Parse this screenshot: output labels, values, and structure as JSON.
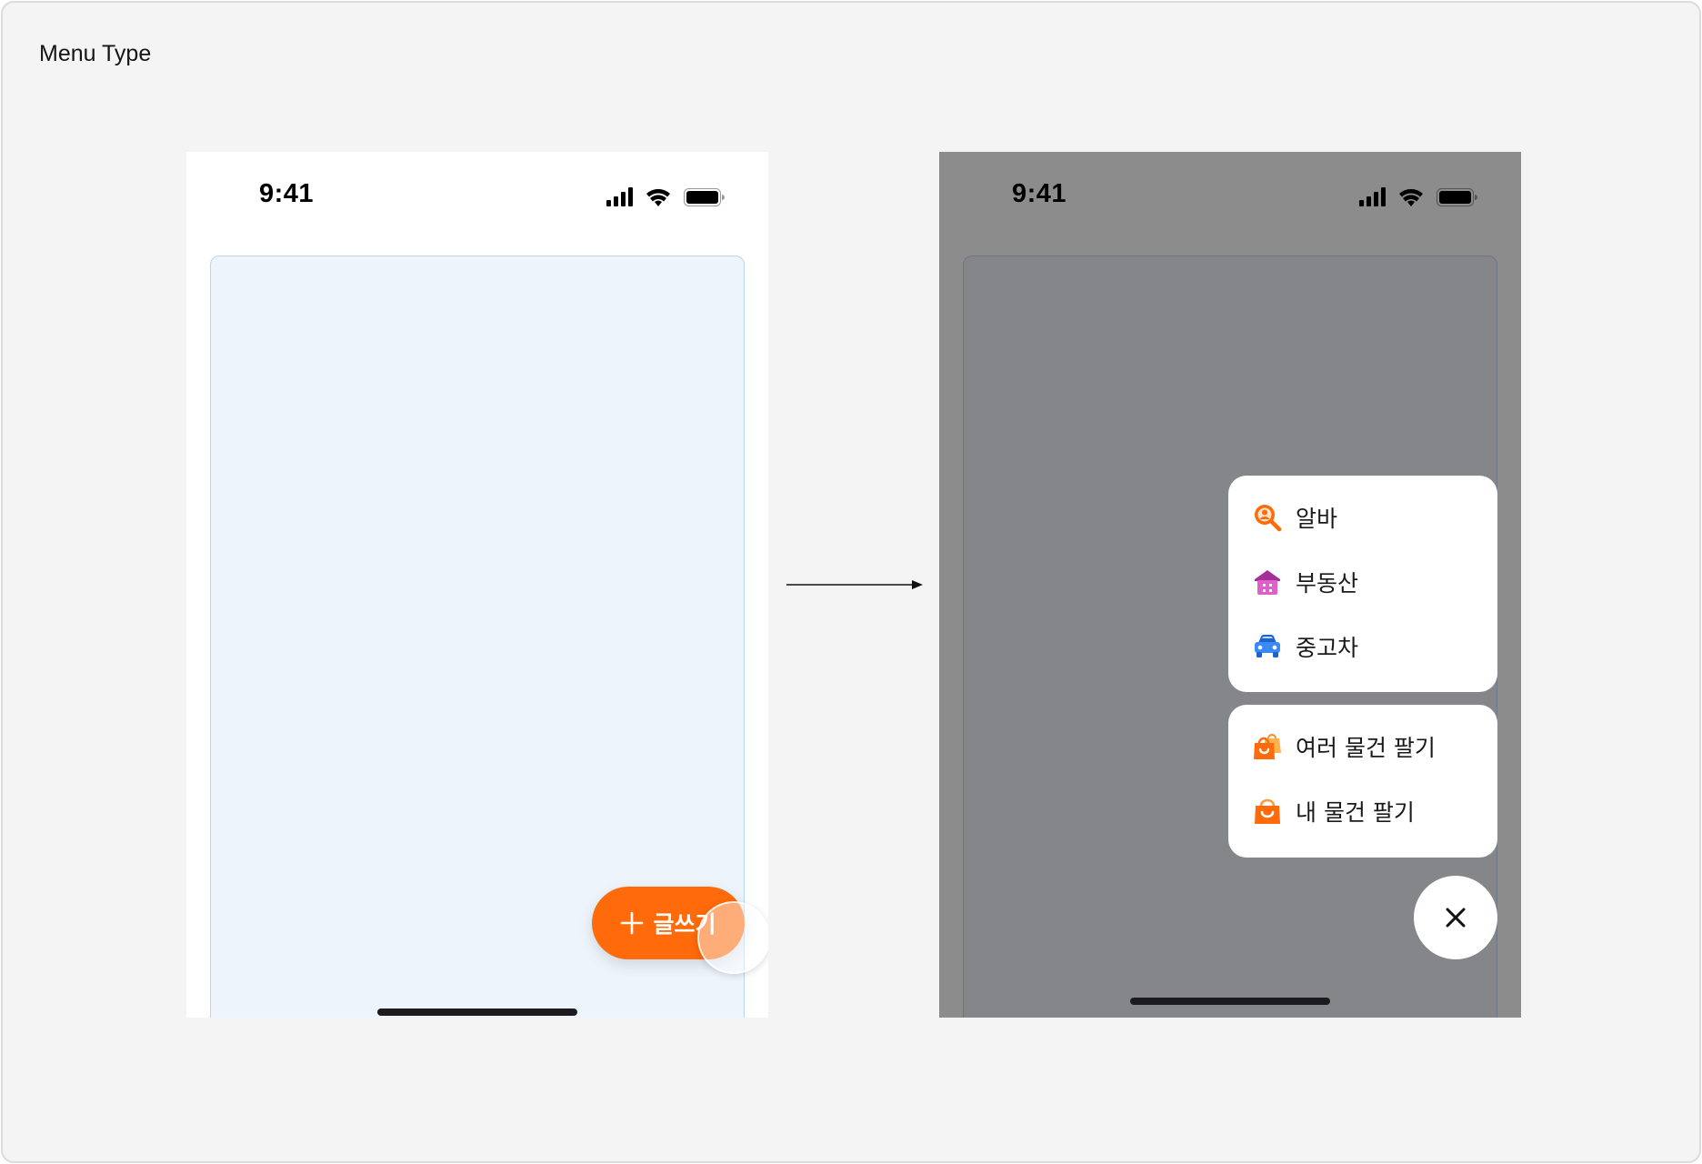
{
  "frame": {
    "title": "Menu Type"
  },
  "before": {
    "status_time": "9:41",
    "fab": {
      "label": "글쓰기"
    }
  },
  "after": {
    "status_time": "9:41",
    "menu_primary": [
      {
        "label": "알바",
        "icon": "job-search-icon",
        "color": "#ff6a0a"
      },
      {
        "label": "부동산",
        "icon": "house-icon",
        "color": "#d64bc3"
      },
      {
        "label": "중고차",
        "icon": "car-icon",
        "color": "#2b7cf0"
      }
    ],
    "menu_secondary": [
      {
        "label": "여러 물건 팔기",
        "icon": "shopping-bags-icon",
        "color": "#ff6a0a"
      },
      {
        "label": "내 물건 팔기",
        "icon": "shopping-bag-icon",
        "color": "#ff6a0a"
      }
    ],
    "close_icon": "close-icon"
  },
  "colors": {
    "brand_orange": "#ff6a0a",
    "dim_overlay": "#8c8c8c",
    "content_bg": "#edf4fc"
  }
}
